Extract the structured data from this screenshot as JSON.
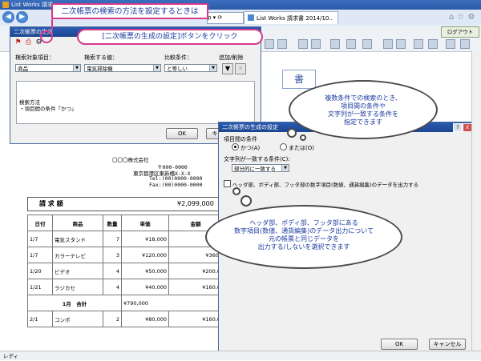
{
  "browser": {
    "window_title": "List Works 請求",
    "tab_label": "List Works 請求書 2014/10..",
    "address_tail": "ρ ▾ ⟳"
  },
  "toolbar": {
    "logout_label": "ログアウト"
  },
  "callouts": {
    "top": "二次帳票の検索の方法を設定するときは",
    "button": "[二次帳票の生成の設定]ボタンをクリック",
    "cloud_conditions": [
      "複数条件での検索のとき、",
      "項目間の条件や",
      "文字列が一致する条件を",
      "指定できます"
    ],
    "cloud_output": [
      "ヘッダ部、ボディ部、フッタ部にある",
      "数字項目(数値、通貨編集)のデータ出力について",
      "元の帳票と同じデータを",
      "出力する/しないを選択できます"
    ]
  },
  "condition_dialog": {
    "title": "二次帳票の生成",
    "col_item": "検索対象項目：",
    "col_value": "検索する値：",
    "col_compare": "比較条件：",
    "col_addremove": "追加/削除",
    "item_value": "商品",
    "search_value": "電気掃除機",
    "compare_value": "と等しい",
    "method_label": "検索方法",
    "method_value": "・項目間の条件「かつ」",
    "ok_label": "OK",
    "cancel_label": "キ"
  },
  "gen_dialog": {
    "title": "二次帳票の生成の設定",
    "item_condition_label": "項目間の条件",
    "radio_and": "かつ(A)",
    "radio_or": "または(O)",
    "string_match_label": "文字列が一致する条件(C):",
    "string_match_value": "部分的に一致する",
    "output_checkbox_label": "ヘッダ部、ボディ部、フッタ部の数字項目(数値、通貨編集)のデータを出力する",
    "ok_label": "OK",
    "cancel_label": "キャンセル",
    "help_label": "?",
    "close_label": "X"
  },
  "document": {
    "company_line": "〇〇〇株式会社",
    "zip": "〒000-0000",
    "address": "東京都港区東新橋X-X-X",
    "tel": "Tel:(00)0000-0000",
    "fax": "Fax:(00)0000-0000",
    "invoice_label": "請 求 額",
    "invoice_total": "¥2,099,000",
    "title_fragment": "書",
    "headers": [
      "日付",
      "商品",
      "数量",
      "単価",
      "金額"
    ],
    "rows": [
      [
        "1/7",
        "電気スタンド",
        "7",
        "¥18,000",
        "¥7"
      ],
      [
        "1/7",
        "カラーテレビ",
        "3",
        "¥120,000",
        "¥360,"
      ],
      [
        "1/20",
        "ビデオ",
        "4",
        "¥50,000",
        "¥200,0"
      ],
      [
        "1/21",
        "ラジカセ",
        "4",
        "¥40,000",
        "¥160,0"
      ]
    ],
    "subtotal_label": "1月　合計",
    "subtotal_value": "¥790,000",
    "last_row": [
      "2/1",
      "コンポ",
      "2",
      "¥80,000",
      "¥160,0"
    ]
  },
  "status_text": "レディ"
}
